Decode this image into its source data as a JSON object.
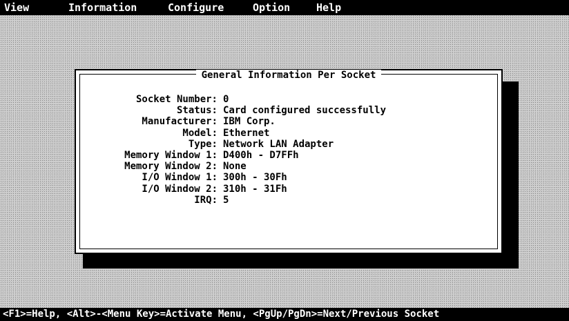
{
  "menu": [
    "View",
    "Information",
    "Configure",
    "Option",
    "Help"
  ],
  "dialog": {
    "title": "General Information Per Socket",
    "fields": [
      {
        "label": "Socket Number:",
        "value": "0"
      },
      {
        "label": "Status:",
        "value": "Card configured successfully"
      },
      {
        "label": "Manufacturer:",
        "value": "IBM Corp."
      },
      {
        "label": "Model:",
        "value": "Ethernet"
      },
      {
        "label": "Type:",
        "value": "Network LAN Adapter"
      },
      {
        "label": "Memory Window 1:",
        "value": "D400h - D7FFh"
      },
      {
        "label": "Memory Window 2:",
        "value": "None"
      },
      {
        "label": "I/O Window 1:",
        "value": "300h - 30Fh"
      },
      {
        "label": "I/O Window 2:",
        "value": "310h - 31Fh"
      },
      {
        "label": "IRQ:",
        "value": "5"
      }
    ]
  },
  "status_bar": "<F1>=Help, <Alt>-<Menu Key>=Activate Menu, <PgUp/PgDn>=Next/Previous Socket"
}
